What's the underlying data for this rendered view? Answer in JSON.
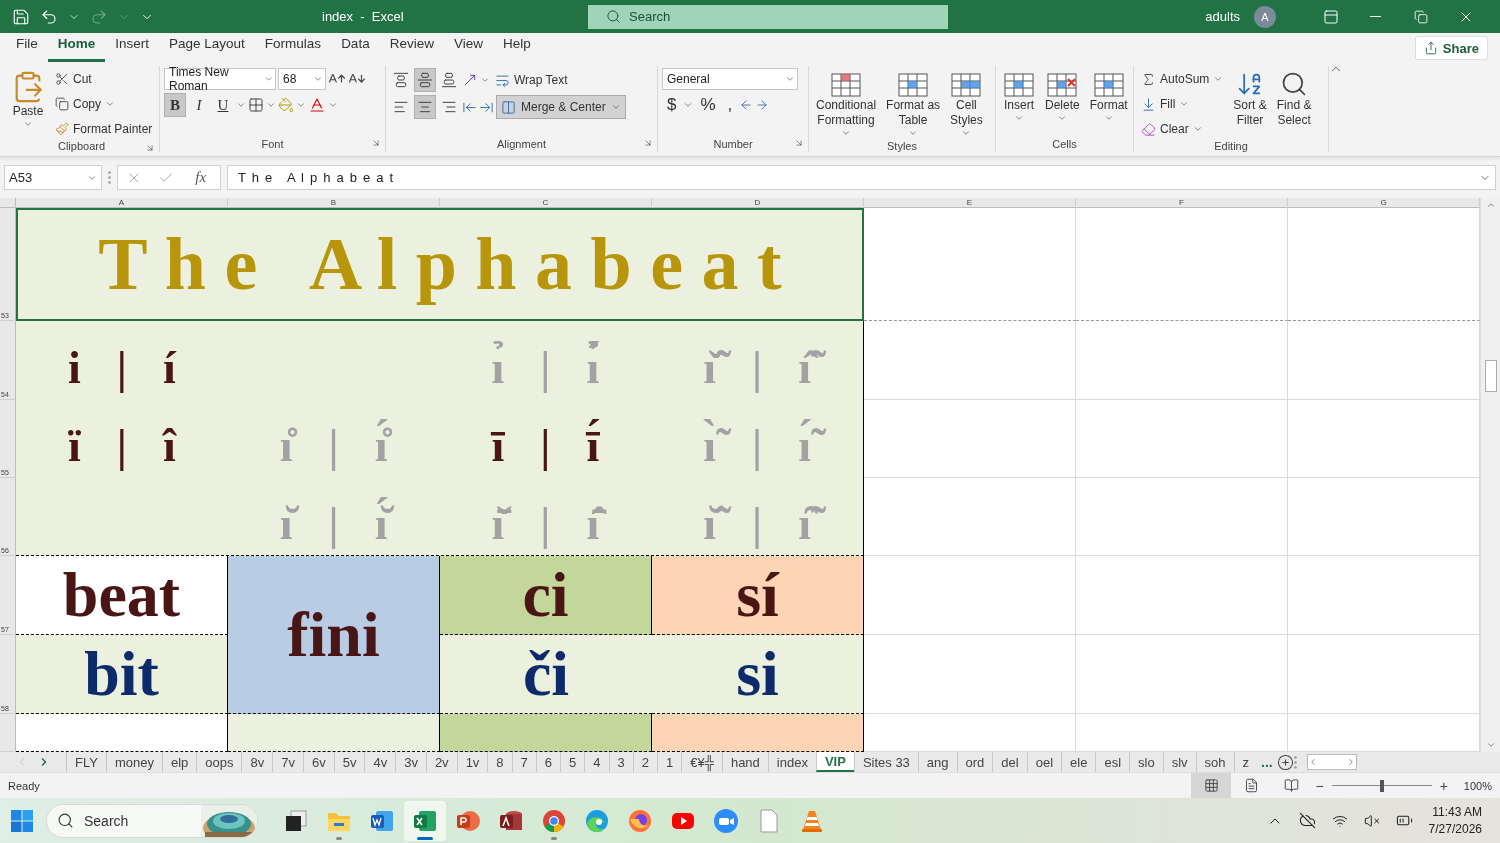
{
  "title_bar": {
    "title": "index  -  Excel",
    "search": {
      "placeholder": "Search"
    },
    "user": "adults",
    "avatar": "A"
  },
  "menu_tabs": [
    {
      "label": "File",
      "selected": false
    },
    {
      "label": "Home",
      "selected": true
    },
    {
      "label": "Insert",
      "selected": false
    },
    {
      "label": "Page Layout",
      "selected": false
    },
    {
      "label": "Formulas",
      "selected": false
    },
    {
      "label": "Data",
      "selected": false
    },
    {
      "label": "Review",
      "selected": false
    },
    {
      "label": "View",
      "selected": false
    },
    {
      "label": "Help",
      "selected": false
    }
  ],
  "share": "Share",
  "ribbon": {
    "clipboard": {
      "label": "Clipboard",
      "paste": "Paste",
      "cut": "Cut",
      "copy": "Copy",
      "format_painter": "Format Painter"
    },
    "font": {
      "label": "Font",
      "font_name": "Times New Roman",
      "font_size": "68",
      "styles": [
        {
          "label": "B",
          "kind": "bold",
          "selected": true
        },
        {
          "label": "I",
          "kind": "italic",
          "selected": false
        },
        {
          "label": "U",
          "kind": "underline",
          "selected": false
        }
      ]
    },
    "alignment": {
      "label": "Alignment",
      "vertical": [
        {
          "kind": "top",
          "selected": false
        },
        {
          "kind": "middle",
          "selected": true
        },
        {
          "kind": "bottom",
          "selected": false
        }
      ],
      "horizontal": [
        {
          "kind": "left",
          "selected": false
        },
        {
          "kind": "center",
          "selected": true
        },
        {
          "kind": "right",
          "selected": false
        }
      ],
      "wrap_text": "Wrap Text",
      "merge_center": {
        "label": "Merge & Center",
        "selected": true
      }
    },
    "number": {
      "label": "Number",
      "format": "General",
      "currency": "$",
      "percent": "%",
      "comma": ","
    },
    "styles": {
      "label": "Styles",
      "buttons": [
        {
          "kind": "conditional",
          "lines": [
            "Conditional",
            "Formatting"
          ]
        },
        {
          "kind": "table",
          "lines": [
            "Format as",
            "Table"
          ]
        },
        {
          "kind": "cell",
          "lines": [
            "Cell",
            "Styles"
          ]
        }
      ]
    },
    "cells": {
      "label": "Cells",
      "buttons": [
        {
          "kind": "insert",
          "lines": [
            "Insert"
          ]
        },
        {
          "kind": "delete",
          "lines": [
            "Delete"
          ]
        },
        {
          "kind": "format",
          "lines": [
            "Format"
          ]
        }
      ]
    },
    "editing": {
      "label": "Editing",
      "autosum": "AutoSum",
      "fill": "Fill",
      "clear": "Clear",
      "buttons": [
        {
          "kind": "sort",
          "lines": [
            "Sort &",
            "Filter"
          ]
        },
        {
          "kind": "find",
          "lines": [
            "Find &",
            "Select"
          ]
        }
      ]
    }
  },
  "formula_bar": {
    "name_box": "A53",
    "fx": "fx",
    "content": "T h e   A l p h a b e a t"
  },
  "sheet": {
    "columns": [
      "A",
      "B",
      "C",
      "D",
      "E",
      "F",
      "G"
    ],
    "rows": [
      "53",
      "54",
      "55",
      "56",
      "57",
      "58"
    ],
    "title": "T h e   A l p h a b e a t",
    "glyph_rows": [
      {
        "cells": [
          {
            "kind": "pair",
            "left": "i",
            "separator": "|",
            "right": "í",
            "faint": false
          },
          {
            "kind": "blank"
          },
          {
            "kind": "pair",
            "left": "ı̉",
            "separator": "|",
            "right": "ı̉́",
            "faint": true
          },
          {
            "kind": "pair",
            "left": "ı̌̃",
            "separator": "|",
            "right": "ı̂̃",
            "faint": true
          }
        ]
      },
      {
        "cells": [
          {
            "kind": "pair",
            "left": "ï",
            "separator": "|",
            "right": "î",
            "faint": false
          },
          {
            "kind": "pair",
            "left": "ı̊",
            "separator": "|",
            "right": "ı̊́",
            "faint": true
          },
          {
            "kind": "pair",
            "left": "ī",
            "separator": "|",
            "right": "ī́",
            "faint": false
          },
          {
            "kind": "pair",
            "left": "ı̀̃",
            "separator": "|",
            "right": "ı́̃",
            "faint": true
          }
        ]
      },
      {
        "cells": [
          {
            "kind": "blank"
          },
          {
            "kind": "pair",
            "left": "ı̆",
            "separator": "|",
            "right": "ı̆́",
            "faint": true
          },
          {
            "kind": "pair",
            "left": "ı̌̄",
            "separator": "|",
            "right": "ı̂̄",
            "faint": true
          },
          {
            "kind": "pair",
            "left": "ı̆̃",
            "separator": "|",
            "right": "ı̑̃",
            "faint": true
          }
        ]
      }
    ],
    "word_rows": [
      {
        "kind": "dark",
        "cells": [
          {
            "kind": "word",
            "text": "beat",
            "color": "#ffffff",
            "merged_down": false,
            "joined_right": false
          },
          {
            "kind": "word",
            "text": "fini",
            "color": "#b8cce4",
            "merged_down": true,
            "joined_right": false
          },
          {
            "kind": "word",
            "text": "ci",
            "color": "#c4d79b",
            "merged_down": false,
            "joined_right": false
          },
          {
            "kind": "word",
            "text": "sí",
            "color": "#fcd5b4",
            "merged_down": false,
            "joined_right": false
          }
        ]
      },
      {
        "kind": "blue",
        "cells": [
          {
            "kind": "word",
            "text": "bit",
            "color": "#ebf1de",
            "merged_down": false,
            "joined_right": false
          },
          {
            "kind": "word",
            "text": "či",
            "color": "#ebf1de",
            "merged_down": false,
            "joined_right": true
          },
          {
            "kind": "word",
            "text": "si",
            "color": "#ebf1de",
            "merged_down": false,
            "joined_right": false
          }
        ]
      },
      {
        "kind": "blank",
        "cells": [
          {
            "kind": "blank",
            "color": "#ffffff",
            "merged_down": false,
            "joined_right": false
          },
          {
            "kind": "blank",
            "color": "#ebf1de",
            "merged_down": false,
            "joined_right": false
          },
          {
            "kind": "blank",
            "color": "#c4d79b",
            "merged_down": false,
            "joined_right": false
          },
          {
            "kind": "blank",
            "color": "#fcd5b4",
            "merged_down": false,
            "joined_right": false
          }
        ]
      }
    ]
  },
  "sheet_tabs": [
    {
      "label": "FLY",
      "selected": false
    },
    {
      "label": "money",
      "selected": false
    },
    {
      "label": "elp",
      "selected": false
    },
    {
      "label": "oops",
      "selected": false
    },
    {
      "label": "8v",
      "selected": false
    },
    {
      "label": "7v",
      "selected": false
    },
    {
      "label": "6v",
      "selected": false
    },
    {
      "label": "5v",
      "selected": false
    },
    {
      "label": "4v",
      "selected": false
    },
    {
      "label": "3v",
      "selected": false
    },
    {
      "label": "2v",
      "selected": false
    },
    {
      "label": "1v",
      "selected": false
    },
    {
      "label": "8",
      "selected": false
    },
    {
      "label": "7",
      "selected": false
    },
    {
      "label": "6",
      "selected": false
    },
    {
      "label": "5",
      "selected": false
    },
    {
      "label": "4",
      "selected": false
    },
    {
      "label": "3",
      "selected": false
    },
    {
      "label": "2",
      "selected": false
    },
    {
      "label": "1",
      "selected": false
    },
    {
      "label": "€¥╬",
      "selected": false
    },
    {
      "label": "hand",
      "selected": false
    },
    {
      "label": "index",
      "selected": false
    },
    {
      "label": "VIP",
      "selected": true
    },
    {
      "label": "Sites 33",
      "selected": false
    },
    {
      "label": "ang",
      "selected": false
    },
    {
      "label": "ord",
      "selected": false
    },
    {
      "label": "del",
      "selected": false
    },
    {
      "label": "oel",
      "selected": false
    },
    {
      "label": "ele",
      "selected": false
    },
    {
      "label": "esl",
      "selected": false
    },
    {
      "label": "slo",
      "selected": false
    },
    {
      "label": "slv",
      "selected": false
    },
    {
      "label": "soh",
      "selected": false
    },
    {
      "label": "z",
      "selected": false
    }
  ],
  "more_tabs": "...",
  "status_bar": {
    "text": "Ready",
    "views": [
      {
        "kind": "normal",
        "selected": true
      },
      {
        "kind": "page_layout",
        "selected": false
      },
      {
        "kind": "page_break",
        "selected": false
      }
    ],
    "zoom": {
      "minus": "−",
      "plus": "+",
      "level": 0.5,
      "reading": "100%"
    }
  },
  "taskbar": {
    "search": {
      "placeholder": "Search"
    },
    "apps": [
      {
        "kind": "task_view",
        "active": false,
        "running": false
      },
      {
        "kind": "folder",
        "active": false,
        "running": true
      },
      {
        "kind": "document",
        "active": false,
        "running": false
      },
      {
        "kind": "spreadsheet",
        "active": true,
        "running": true
      },
      {
        "kind": "presentation",
        "active": false,
        "running": false
      },
      {
        "kind": "database",
        "active": false,
        "running": false
      },
      {
        "kind": "browser_round",
        "active": false,
        "running": true
      },
      {
        "kind": "browser_wave",
        "active": false,
        "running": false
      },
      {
        "kind": "browser_fox",
        "active": false,
        "running": false
      },
      {
        "kind": "video",
        "active": false,
        "running": false
      },
      {
        "kind": "video_call",
        "active": false,
        "running": false
      },
      {
        "kind": "file",
        "active": false,
        "running": false
      },
      {
        "kind": "cone",
        "active": false,
        "running": false
      }
    ],
    "time": "11:43 AM",
    "date": "7/27/2026"
  }
}
